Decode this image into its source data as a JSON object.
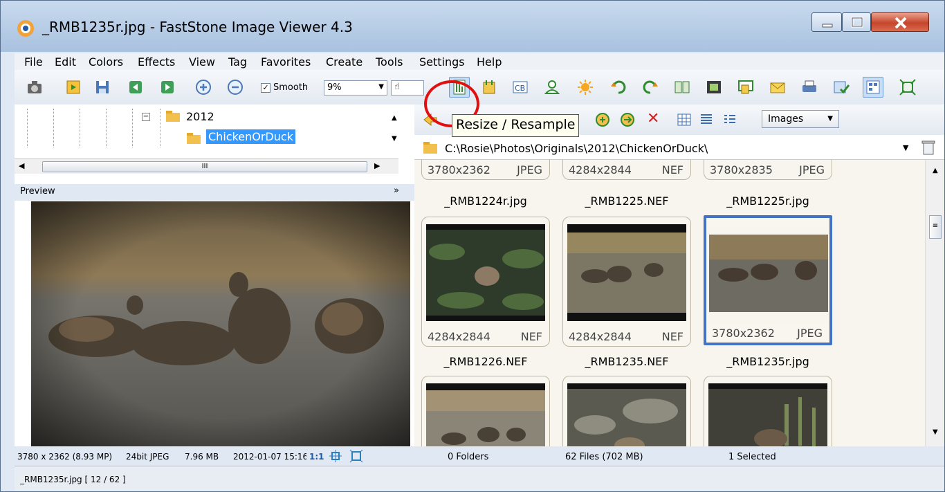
{
  "window": {
    "title": "_RMB1235r.jpg  -  FastStone Image Viewer 4.3"
  },
  "menu": [
    "File",
    "Edit",
    "Colors",
    "Effects",
    "View",
    "Tag",
    "Favorites",
    "Create",
    "Tools",
    "Settings",
    "Help"
  ],
  "toolbar": {
    "smooth_label": "Smooth",
    "smooth_checked": true,
    "zoom_value": "9%",
    "tooltip": "Resize / Resample"
  },
  "tree": {
    "parent_folder": "2012",
    "selected_folder": "ChickenOrDuck",
    "scroll_marker": "III"
  },
  "preview": {
    "label": "Preview",
    "collapse_glyph": "»"
  },
  "left_status": {
    "dimensions": "3780 x 2362 (8.93 MP)",
    "format": "24bit JPEG",
    "size": "7.96 MB",
    "date": "2012-01-07 15:16",
    "ratio": "1:1"
  },
  "browser": {
    "filter_value": "Images",
    "path": "C:\\Rosie\\Photos\\Originals\\2012\\ChickenOrDuck\\"
  },
  "thumbnails": {
    "top_row_info": [
      {
        "dims": "3780x2362",
        "type": "JPEG"
      },
      {
        "dims": "4284x2844",
        "type": "NEF"
      },
      {
        "dims": "3780x2835",
        "type": "JPEG"
      }
    ],
    "row1_names": [
      "_RMB1224r.jpg",
      "_RMB1225.NEF",
      "_RMB1225r.jpg"
    ],
    "row2": [
      {
        "dims": "4284x2844",
        "type": "NEF"
      },
      {
        "dims": "4284x2844",
        "type": "NEF"
      },
      {
        "dims": "3780x2362",
        "type": "JPEG"
      }
    ],
    "row2_names": [
      "_RMB1226.NEF",
      "_RMB1235.NEF",
      "_RMB1235r.jpg"
    ]
  },
  "right_status": {
    "folders": "0 Folders",
    "files": "62 Files (702 MB)",
    "selected": "1 Selected"
  },
  "bottom_status": "_RMB1235r.jpg [ 12 / 62 ]",
  "colors": {
    "selection_blue": "#3399ff",
    "thumb_border_selected": "#4472c4",
    "annotation_red": "#e01010"
  }
}
